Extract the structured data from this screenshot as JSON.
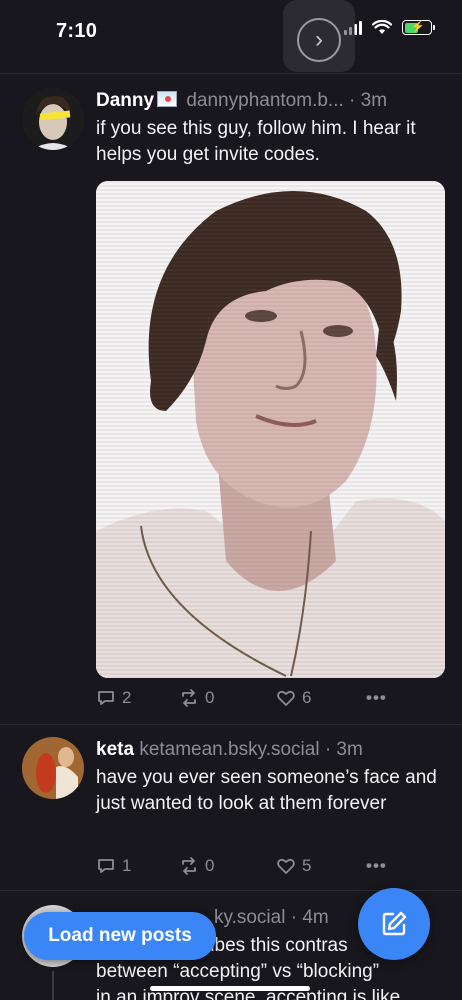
{
  "status_bar": {
    "time": "7:10"
  },
  "posts": [
    {
      "name": "Danny",
      "handle": "dannyphantom.b...",
      "time": "· 3m",
      "text": "if you see this guy, follow him. I hear it helps you get invite codes.",
      "image_alt": "photo of a young man with swept dark hair",
      "replies": "2",
      "reposts": "0",
      "likes": "6"
    },
    {
      "name": "keta",
      "handle": "ketamean.bsky.social",
      "time": "· 3m",
      "text": "have you ever seen someone’s face and just wanted to look at them forever",
      "replies": "1",
      "reposts": "0",
      "likes": "5"
    },
    {
      "handle_partial": "ky.social",
      "time": "· 4m",
      "text_line1": "ribes this contras",
      "text_line2": "between “accepting” vs “blocking”",
      "text_line3": "in an improv scene. accepting is like"
    }
  ],
  "load_new_posts_label": "Load new posts",
  "colors": {
    "accent": "#3b86f7",
    "background": "#17171d",
    "muted": "#8c8c96"
  },
  "icons": [
    "chevron-right-icon",
    "reply-icon",
    "repost-icon",
    "like-icon",
    "more-icon",
    "compose-icon"
  ]
}
